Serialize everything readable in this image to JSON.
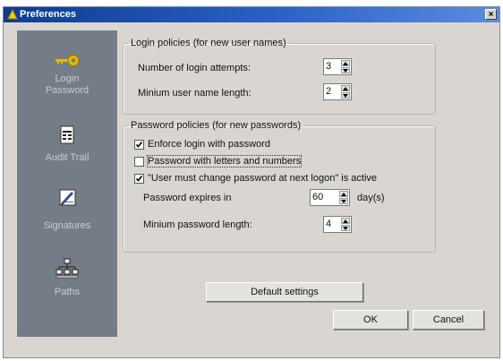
{
  "window": {
    "title": "Preferences",
    "close_label": "×"
  },
  "sidebar": {
    "items": [
      {
        "label_line1": "Login",
        "label_line2": "Password",
        "icon": "key-icon"
      },
      {
        "label_line1": "Audit Trail",
        "icon": "audit-document-icon"
      },
      {
        "label_line1": "Signatures",
        "icon": "signature-pen-icon"
      },
      {
        "label_line1": "Paths",
        "icon": "network-tree-icon"
      }
    ],
    "background": "#747c88"
  },
  "login_policies": {
    "legend": "Login policies (for new user names)",
    "login_attempts_label": "Number of login attempts:",
    "login_attempts_value": "3",
    "min_username_label": "Minium user name length:",
    "min_username_value": "2"
  },
  "password_policies": {
    "legend": "Password policies (for new passwords)",
    "enforce_login": {
      "label": "Enforce login with password",
      "checked": true
    },
    "letters_numbers": {
      "label": "Password with letters and numbers",
      "checked": false
    },
    "must_change": {
      "label": "\"User must change password at next logon\" is active",
      "checked": true
    },
    "expires_label": "Password expires in",
    "expires_value": "60",
    "expires_unit": "day(s)",
    "min_length_label": "Minium password length:",
    "min_length_value": "4"
  },
  "buttons": {
    "default_settings": "Default settings",
    "ok": "OK",
    "cancel": "Cancel"
  },
  "colors": {
    "title_bar": "#0b3d91",
    "dialog_bg": "#d9d6d2",
    "key_icon": "#e6b800"
  }
}
